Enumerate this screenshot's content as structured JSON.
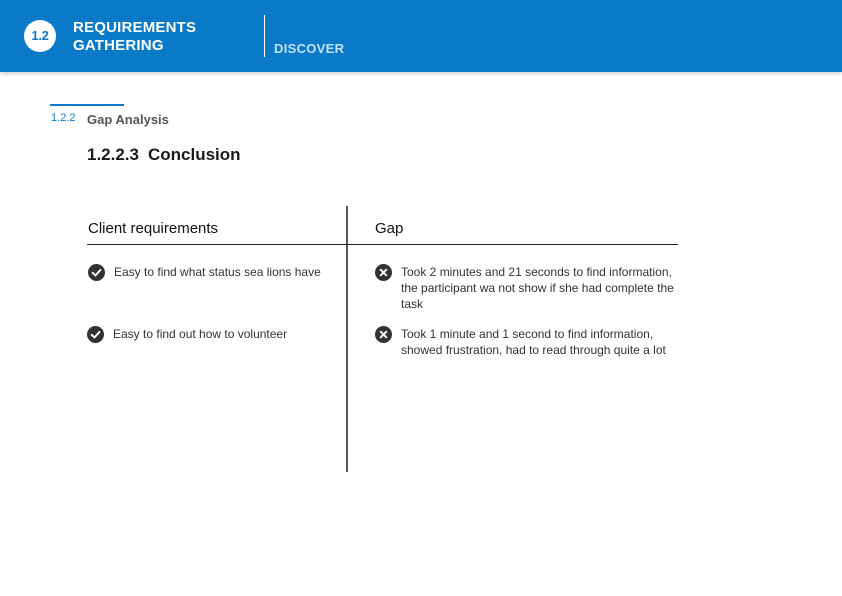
{
  "header": {
    "badge": "1.2",
    "title_line1": "REQUIREMENTS",
    "title_line2": "GATHERING",
    "section": "DISCOVER"
  },
  "subsection": {
    "number": "1.2.2",
    "title": "Gap Analysis"
  },
  "heading": {
    "number": "1.2.2.3",
    "title": "Conclusion"
  },
  "table": {
    "columns": [
      "Client requirements",
      "Gap"
    ],
    "rows": [
      {
        "requirement": "Easy to find what status sea lions have",
        "requirement_icon": "check-circle-icon",
        "gap": "Took 2 minutes and 21 seconds to find information, the participant wa not show if she had complete the task",
        "gap_icon": "x-circle-icon"
      },
      {
        "requirement": "Easy to find out how to volunteer",
        "requirement_icon": "check-circle-icon",
        "gap": "Took 1 minute and 1 second to find information, showed frustration, had to read through quite a lot",
        "gap_icon": "x-circle-icon"
      }
    ]
  },
  "colors": {
    "brand": "#0a7ac8",
    "icon": "#333333"
  }
}
